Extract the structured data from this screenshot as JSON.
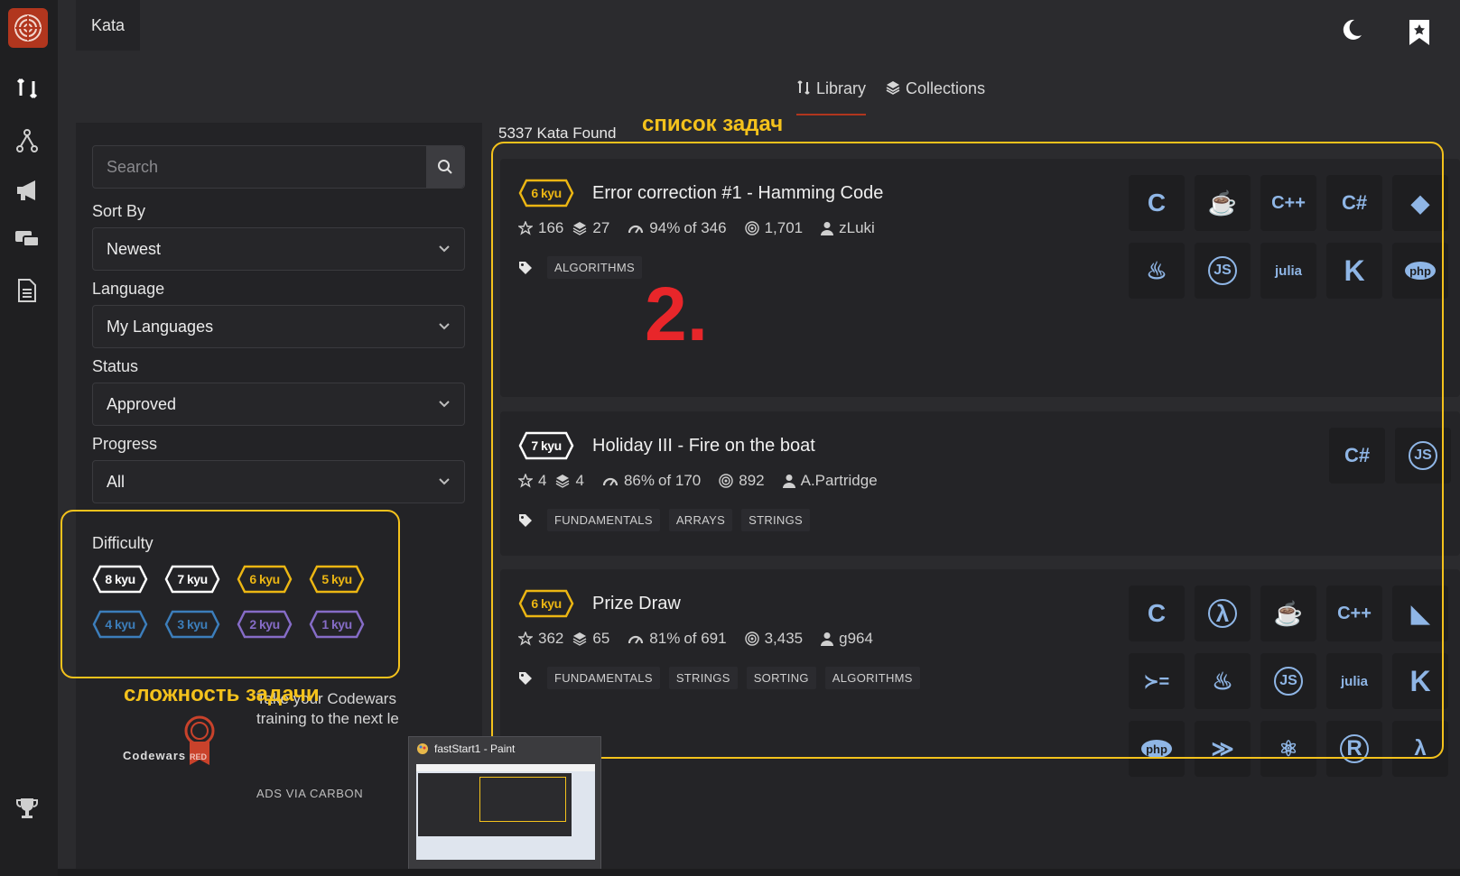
{
  "header": {
    "kata_tab": "Kata"
  },
  "library_tabs": [
    {
      "label": "Library",
      "icon": "library-icon",
      "active": true
    },
    {
      "label": "Collections",
      "icon": "collections-icon",
      "active": false
    }
  ],
  "filters": {
    "search_placeholder": "Search",
    "sort_by": {
      "label": "Sort By",
      "value": "Newest"
    },
    "language": {
      "label": "Language",
      "value": "My Languages"
    },
    "status": {
      "label": "Status",
      "value": "Approved"
    },
    "progress": {
      "label": "Progress",
      "value": "All"
    },
    "difficulty": {
      "label": "Difficulty",
      "levels": [
        {
          "label": "8 kyu",
          "color": "#ffffff"
        },
        {
          "label": "7 kyu",
          "color": "#ffffff"
        },
        {
          "label": "6 kyu",
          "color": "#ecb613"
        },
        {
          "label": "5 kyu",
          "color": "#ecb613"
        },
        {
          "label": "4 kyu",
          "color": "#3c7ebb"
        },
        {
          "label": "3 kyu",
          "color": "#3c7ebb"
        },
        {
          "label": "2 kyu",
          "color": "#866cc7"
        },
        {
          "label": "1 kyu",
          "color": "#866cc7"
        }
      ]
    }
  },
  "ad": {
    "brand": "Codewars",
    "badge": "RED",
    "text_line1": "Take your Codewars",
    "text_line2": "training to the next le",
    "via": "ADS VIA CARBON"
  },
  "results": {
    "found_text": "5337 Kata Found",
    "katas": [
      {
        "kyu": "6 kyu",
        "kyu_color": "#ecb613",
        "title": "Error correction #1 - Hamming Code",
        "stars": "166",
        "collections": "27",
        "satisfaction": "94%",
        "of": "of 346",
        "completed": "1,701",
        "author": "zLuki",
        "tags": [
          "ALGORITHMS"
        ],
        "languages": [
          "c",
          "coffeescript",
          "cpp",
          "csharp",
          "elm",
          "java",
          "javascript",
          "julia",
          "kotlin",
          "php"
        ]
      },
      {
        "kyu": "7 kyu",
        "kyu_color": "#ffffff",
        "title": "Holiday III - Fire on the boat",
        "stars": "4",
        "collections": "4",
        "satisfaction": "86%",
        "of": "of 170",
        "completed": "892",
        "author": "A.Partridge",
        "tags": [
          "FUNDAMENTALS",
          "ARRAYS",
          "STRINGS"
        ],
        "languages": [
          "csharp",
          "javascript"
        ]
      },
      {
        "kyu": "6 kyu",
        "kyu_color": "#ecb613",
        "title": "Prize Draw",
        "stars": "362",
        "collections": "65",
        "satisfaction": "81%",
        "of": "of 691",
        "completed": "3,435",
        "author": "g964",
        "tags": [
          "FUNDAMENTALS",
          "STRINGS",
          "SORTING",
          "ALGORITHMS"
        ],
        "languages": [
          "c",
          "clojure",
          "coffeescript",
          "cpp",
          "dart",
          "elixir",
          "java",
          "javascript",
          "julia",
          "kotlin",
          "php",
          "powershell",
          "python",
          "r",
          "racket"
        ]
      }
    ]
  },
  "annotations": {
    "task_list": "список задач",
    "difficulty": "сложность задачи",
    "marker": "2."
  },
  "taskbar_preview": {
    "title": "fastStart1 - Paint"
  },
  "colors": {
    "accent": "#b1361e",
    "annotation": "#f4c21c",
    "marker": "#e8262a"
  }
}
